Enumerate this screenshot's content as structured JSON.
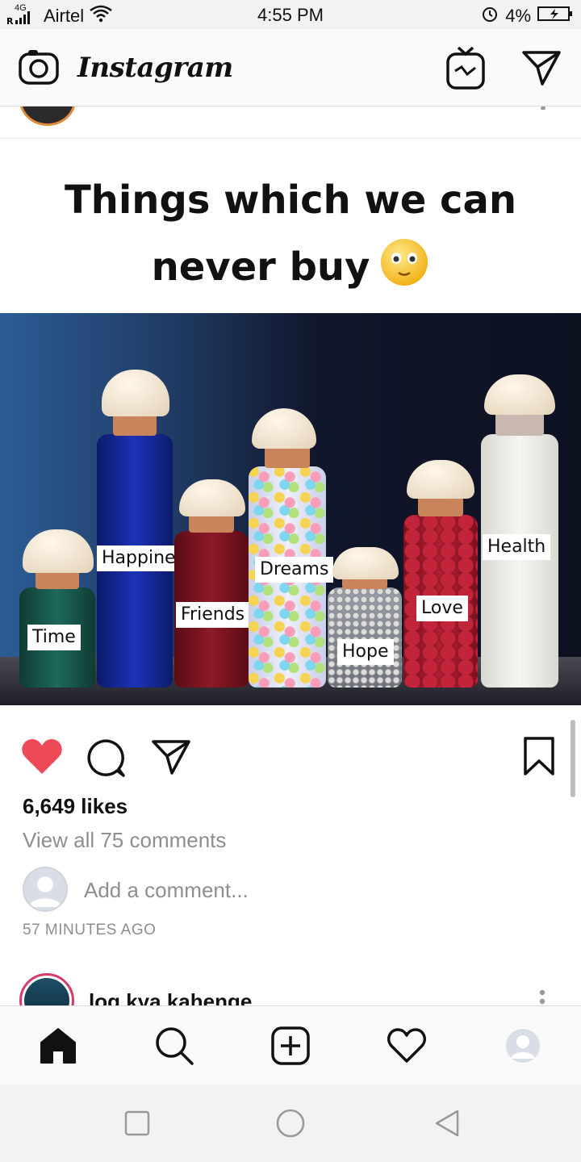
{
  "status_bar": {
    "network": "4G",
    "carrier": "Airtel",
    "time": "4:55 PM",
    "battery": "4%"
  },
  "header": {
    "app_title": "Instagram"
  },
  "post": {
    "caption_line1": "Things which we can",
    "caption_line2": "never buy",
    "jar_labels": [
      "Time",
      "Happiness",
      "Friends",
      "Dreams",
      "Hope",
      "Love",
      "Health"
    ],
    "likes": "6,649 likes",
    "view_comments": "View all 75 comments",
    "comment_placeholder": "Add a comment...",
    "timestamp": "57 MINUTES AGO",
    "liked": true
  },
  "next_post": {
    "username": "log.kya.kahenge"
  },
  "colors": {
    "like_red": "#ed4956",
    "muted_text": "#8e8e8e",
    "story_ring": "#d63b6c"
  },
  "icons": {
    "header_left": "camera-icon",
    "header_igtv": "igtv-icon",
    "header_direct": "direct-send-icon",
    "nav": [
      "home-icon",
      "search-icon",
      "add-post-icon",
      "activity-heart-icon",
      "profile-icon"
    ],
    "system": [
      "recent-apps-icon",
      "home-circle-icon",
      "back-icon"
    ]
  }
}
